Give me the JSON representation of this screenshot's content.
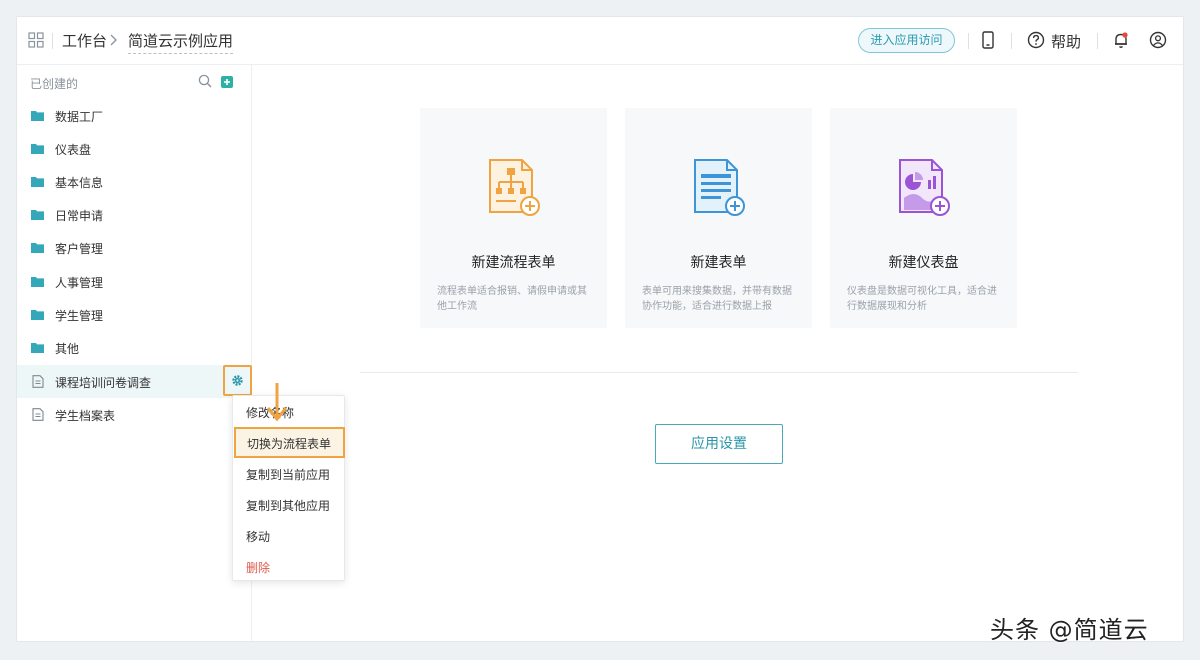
{
  "header": {
    "workbench": "工作台",
    "app_name": "简道云示例应用",
    "visit_button": "进入应用访问",
    "help": "帮助",
    "icons": [
      "grid-icon",
      "chevron-right-icon",
      "mobile-icon",
      "help-circle-icon",
      "bell-icon",
      "user-icon"
    ]
  },
  "sidebar": {
    "heading": "已创建的",
    "items": [
      {
        "label": "数据工厂",
        "icon": "folder-icon"
      },
      {
        "label": "仪表盘",
        "icon": "folder-icon"
      },
      {
        "label": "基本信息",
        "icon": "folder-icon"
      },
      {
        "label": "日常申请",
        "icon": "folder-icon"
      },
      {
        "label": "客户管理",
        "icon": "folder-icon"
      },
      {
        "label": "人事管理",
        "icon": "folder-icon"
      },
      {
        "label": "学生管理",
        "icon": "folder-icon"
      },
      {
        "label": "其他",
        "icon": "folder-icon"
      },
      {
        "label": "课程培训问卷调查",
        "icon": "form-icon"
      },
      {
        "label": "学生档案表",
        "icon": "form-icon"
      }
    ]
  },
  "context_menu": {
    "items": [
      "修改名称",
      "切换为流程表单",
      "复制到当前应用",
      "复制到其他应用",
      "移动",
      "删除"
    ]
  },
  "cards": [
    {
      "title": "新建流程表单",
      "desc": "流程表单适合报销、请假申请或其他工作流"
    },
    {
      "title": "新建表单",
      "desc": "表单可用来搜集数据，并带有数据协作功能，适合进行数据上报"
    },
    {
      "title": "新建仪表盘",
      "desc": "仪表盘是数据可视化工具，适合进行数据展现和分析"
    }
  ],
  "settings_button": "应用设置",
  "watermark": "头条 @简道云",
  "colors": {
    "accent": "#2a9bb3",
    "folder": "#34a7b8",
    "highlight_border": "#f0a341",
    "danger": "#e05a4e"
  }
}
